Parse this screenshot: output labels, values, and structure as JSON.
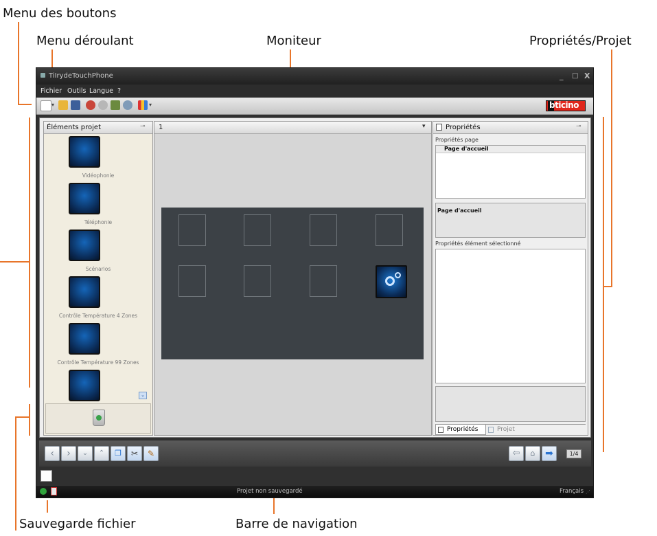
{
  "callouts": {
    "menu_boutons": "Menu des boutons",
    "menu_deroulant": "Menu déroulant",
    "moniteur": "Moniteur",
    "proprietes_projet": "Propriétés/Projet",
    "sauvegarde": "Sauvegarde fichier",
    "barre_navigation": "Barre de navigation"
  },
  "window": {
    "title": "TiIrydeTouchPhone",
    "controls": [
      "_",
      "□",
      "X"
    ]
  },
  "menubar": {
    "items": [
      "Fichier",
      "Outils",
      "Langue",
      "?"
    ]
  },
  "toolbar": {
    "brand": "bticino"
  },
  "left_panel": {
    "title": "Éléments projet",
    "elements": [
      {
        "label": "Vidéophonie",
        "icon": "videophone-icon"
      },
      {
        "label": "Téléphonie",
        "icon": "telephone-icon"
      },
      {
        "label": "Scénarios",
        "icon": "scenarios-icon"
      },
      {
        "label": "Contrôle Température 4 Zones",
        "icon": "thermometer-icon"
      },
      {
        "label": "Contrôle Température 99 Zones",
        "icon": "thermometer-icon"
      },
      {
        "label": "",
        "icon": "speaker-icon"
      }
    ]
  },
  "monitor": {
    "page_select": "1"
  },
  "right_panel": {
    "title": "Propriétés",
    "page_props_label": "Propriétés page",
    "page_props_header": "Page d'accueil",
    "page_desc": "Page d'accueil",
    "selected_label": "Propriétés élément sélectionné",
    "tabs": [
      "Propriétés",
      "Projet"
    ]
  },
  "navbar": {
    "page_counter": "1/4"
  },
  "statusbar": {
    "status": "Projet non sauvegardé",
    "language": "Français"
  },
  "colors": {
    "callout_line": "#e8752a",
    "monitor_bg": "#3c4146",
    "window_bg": "#303030",
    "brand_red": "#e0261b"
  }
}
